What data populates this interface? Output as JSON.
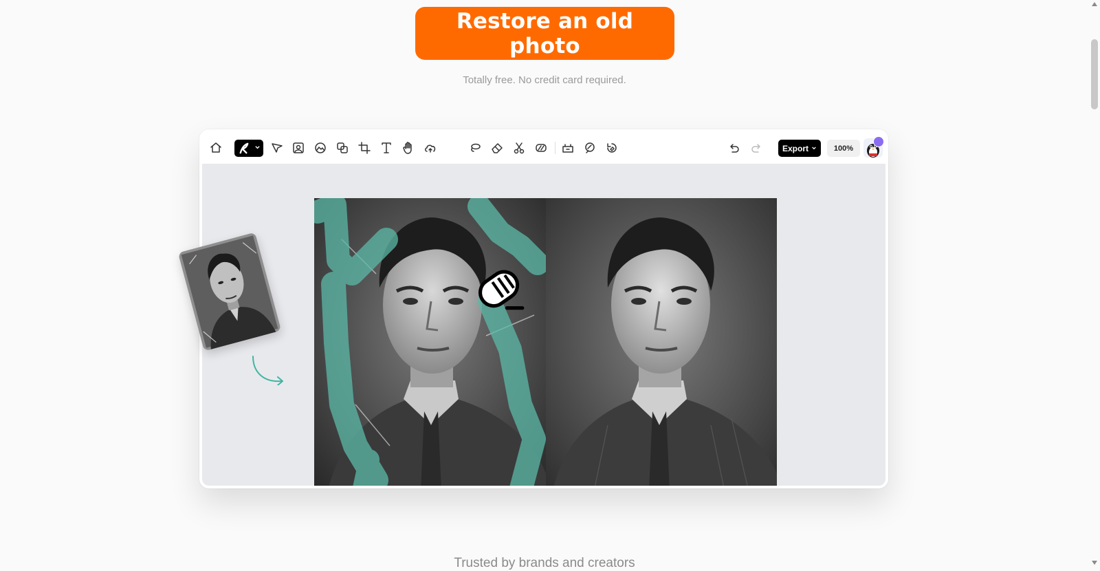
{
  "cta": {
    "label": "Restore an old photo"
  },
  "subtitle": "Totally free. No credit card required.",
  "trusted": "Trusted by brands and creators",
  "colors": {
    "accent": "#ff6a00",
    "brush": "#5bb9a8",
    "canvas": "#e8e9ed",
    "export": "#000000"
  },
  "editor": {
    "toolbar": {
      "tools": [
        {
          "icon": "home-icon"
        },
        {
          "icon": "brush-icon",
          "selected": true
        },
        {
          "icon": "pointer-icon"
        },
        {
          "icon": "image-frame-icon"
        },
        {
          "icon": "palette-icon"
        },
        {
          "icon": "layers-icon"
        },
        {
          "icon": "crop-icon"
        },
        {
          "icon": "text-icon"
        },
        {
          "icon": "hand-icon"
        },
        {
          "icon": "upload-cloud-icon"
        },
        {
          "icon": "lasso-icon"
        },
        {
          "icon": "eraser-icon"
        },
        {
          "icon": "scissors-icon"
        },
        {
          "icon": "mask-icon"
        },
        {
          "icon": "cut-object-icon"
        },
        {
          "icon": "magic-brush-icon"
        },
        {
          "icon": "ai-edit-icon"
        },
        {
          "icon": "undo-icon"
        },
        {
          "icon": "redo-icon"
        }
      ],
      "export_label": "Export",
      "zoom_label": "100%"
    }
  }
}
